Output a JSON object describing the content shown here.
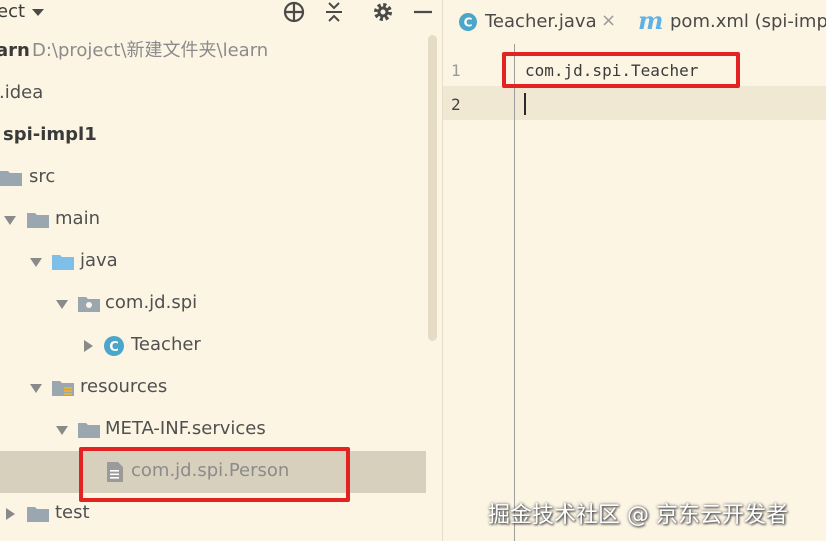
{
  "project_panel": {
    "title": "ect",
    "tree": [
      {
        "label": "arn",
        "path": "D:\\project\\新建文件夹\\learn",
        "icon": "module-icon"
      },
      {
        "label": ".idea",
        "icon": "folder-icon"
      },
      {
        "label": "spi-impl1",
        "icon": "module-icon"
      },
      {
        "label": "src",
        "icon": "folder-icon"
      },
      {
        "label": "main",
        "icon": "folder-icon"
      },
      {
        "label": "java",
        "icon": "source-folder-icon"
      },
      {
        "label": "com.jd.spi",
        "icon": "package-icon"
      },
      {
        "label": "Teacher",
        "icon": "class-icon"
      },
      {
        "label": "resources",
        "icon": "resources-folder-icon"
      },
      {
        "label": "META-INF.services",
        "icon": "folder-icon"
      },
      {
        "label": "com.jd.spi.Person",
        "icon": "text-file-icon"
      },
      {
        "label": "test",
        "icon": "folder-icon"
      }
    ]
  },
  "editor": {
    "tabs": [
      {
        "label": "Teacher.java",
        "icon": "class-icon",
        "close": "×"
      },
      {
        "label": "pom.xml (spi-impl",
        "icon": "maven-icon",
        "glyph": "m"
      }
    ],
    "line_numbers": [
      "1",
      "2"
    ],
    "lines": [
      "com.jd.spi.Teacher",
      ""
    ]
  },
  "watermark": "掘金技术社区 @ 京东云开发者",
  "colors": {
    "background": "#fdf5e4",
    "selection": "#d7d0bd",
    "annotation_red": "#e32222",
    "class_icon": "#4ba6c9",
    "folder": "#9aa7b0",
    "source_folder": "#7dbfe6"
  }
}
